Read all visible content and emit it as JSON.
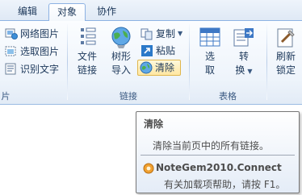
{
  "tabs": [
    {
      "label": "编辑",
      "active": false
    },
    {
      "label": "对象",
      "active": true
    },
    {
      "label": "协作",
      "active": false
    }
  ],
  "groups": {
    "left": {
      "label": "片",
      "items": [
        "网络图片",
        "选取图片",
        "识别文字"
      ]
    },
    "links": {
      "label": "链接",
      "file_link": [
        "文件",
        "链接"
      ],
      "tree_import": [
        "树形",
        "导入"
      ],
      "copy": "复制",
      "paste": "粘贴",
      "clear": "清除"
    },
    "table": {
      "label": "表格",
      "select": [
        "选",
        "取"
      ],
      "convert": [
        "转",
        "换"
      ]
    },
    "right": {
      "refresh_lock": [
        "刷新",
        "锁定"
      ]
    }
  },
  "tooltip": {
    "title": "清除",
    "description": "清除当前页中的所有链接。",
    "addin_name": "NoteGem2010.Connect",
    "help_text": "有关加载项帮助，请按 F1。"
  },
  "colors": {
    "ribbon_border": "#8db2e3",
    "text": "#1e395b",
    "hover_fill": "#ffe7a2",
    "hover_border": "#e0b64d"
  }
}
